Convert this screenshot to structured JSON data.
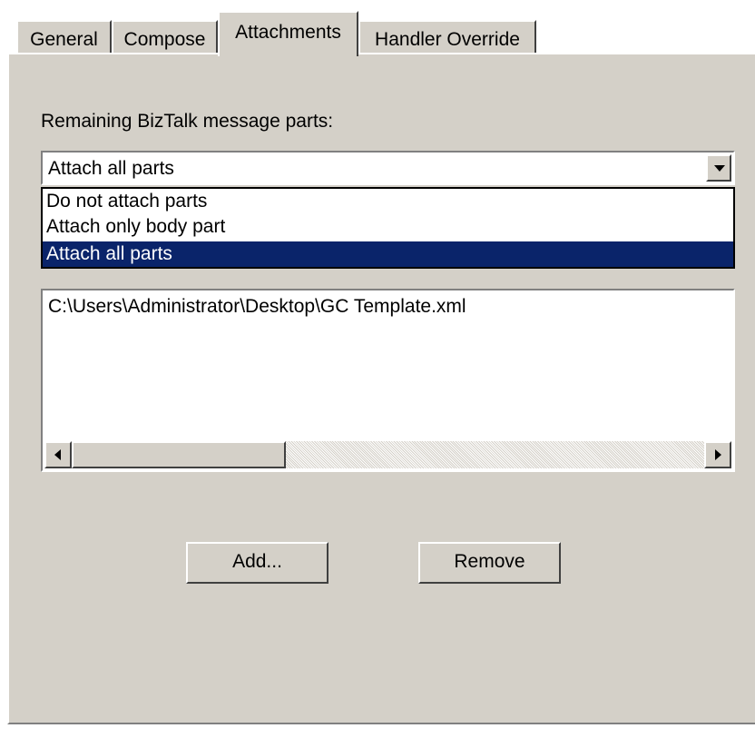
{
  "tabs": [
    {
      "label": "General",
      "active": false
    },
    {
      "label": "Compose",
      "active": false
    },
    {
      "label": "Attachments",
      "active": true
    },
    {
      "label": "Handler Override",
      "active": false
    }
  ],
  "attachments": {
    "message_parts_label": "Remaining BizTalk message parts:",
    "selected_option": "Attach all parts",
    "options": [
      {
        "label": "Do not attach parts",
        "selected": false
      },
      {
        "label": "Attach only body part",
        "selected": false
      },
      {
        "label": "Attach all parts",
        "selected": true
      }
    ],
    "files": [
      "C:\\Users\\Administrator\\Desktop\\GC Template.xml"
    ],
    "add_button": "Add...",
    "remove_button": "Remove"
  },
  "colors": {
    "dialog_face": "#d4d0c8",
    "selection": "#0a246a",
    "selection_text": "#ffffff"
  },
  "icons": {
    "dropdown_arrow": "chevron-down-icon",
    "scroll_left": "arrow-left-icon",
    "scroll_right": "arrow-right-icon"
  }
}
